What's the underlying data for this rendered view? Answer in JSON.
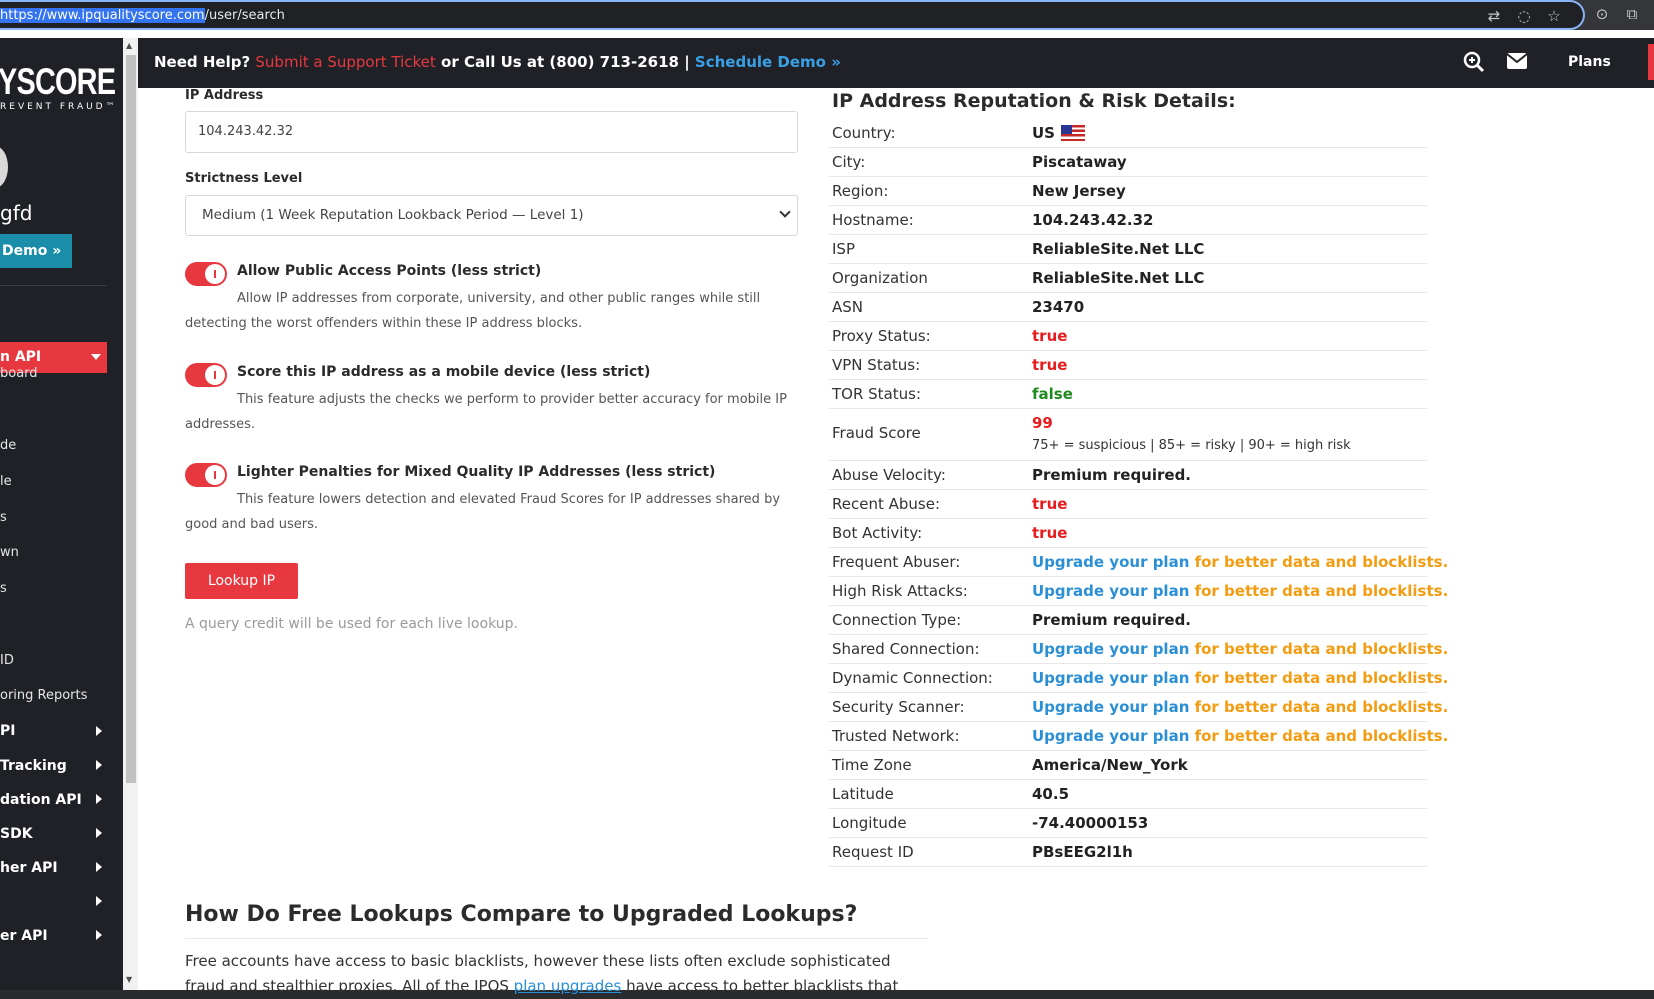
{
  "browser": {
    "url_selected": "https://www.ipqualityscore.com",
    "url_rest": "/user/search",
    "icons": [
      "translate-icon",
      "eye-off-icon",
      "star-icon",
      "share-icon",
      "extensions-icon"
    ]
  },
  "sidebar": {
    "brand": "YSCORE",
    "tagline": "REVENT FRAUD™",
    "username": "gfd",
    "demo_button": "Demo »",
    "active_item": "n API",
    "items": [
      {
        "label": "board"
      },
      {
        "label": "de"
      },
      {
        "label": "le"
      },
      {
        "label": "s"
      },
      {
        "label": "wn"
      },
      {
        "label": "s"
      },
      {
        "label": "ID"
      },
      {
        "label": "oring Reports"
      }
    ],
    "expandable": [
      {
        "label": "PI"
      },
      {
        "label": "Tracking"
      },
      {
        "label": "dation API"
      },
      {
        "label": "SDK"
      },
      {
        "label": "her API"
      },
      {
        "label": ""
      },
      {
        "label": "er API"
      }
    ]
  },
  "topnav": {
    "need_help": "Need Help?",
    "ticket": "Submit a Support Ticket",
    "call": "or Call Us at (800) 713-2618 |",
    "demo": "Schedule Demo »",
    "plans": "Plans"
  },
  "form": {
    "ip_label": "IP Address",
    "ip_value": "104.243.42.32",
    "strictness_label": "Strictness Level",
    "strictness_value": "Medium (1 Week Reputation Lookback Period — Level 1)",
    "options": [
      {
        "title": "Allow Public Access Points (less strict)",
        "desc": "Allow IP addresses from corporate, university, and other public ranges while still detecting the worst offenders within these IP address blocks.",
        "enabled": true
      },
      {
        "title": "Score this IP address as a mobile device (less strict)",
        "desc": "This feature adjusts the checks we perform to provider better accuracy for mobile IP addresses.",
        "enabled": true
      },
      {
        "title": "Lighter Penalties for Mixed Quality IP Addresses (less strict)",
        "desc": "This feature lowers detection and elevated Fraud Scores for IP addresses shared by good and bad users.",
        "enabled": true
      }
    ],
    "lookup_button": "Lookup IP",
    "credit_note": "A query credit will be used for each live lookup."
  },
  "details": {
    "title": "IP Address Reputation & Risk Details:",
    "upgrade_link": "Upgrade your plan",
    "upgrade_rest": " for better data and blocklists.",
    "rows": [
      {
        "key": "Country:",
        "value": "US"
      },
      {
        "key": "City:",
        "value": "Piscataway"
      },
      {
        "key": "Region:",
        "value": "New Jersey"
      },
      {
        "key": "Hostname:",
        "value": "104.243.42.32"
      },
      {
        "key": "ISP",
        "value": "ReliableSite.Net LLC"
      },
      {
        "key": "Organization",
        "value": "ReliableSite.Net LLC"
      },
      {
        "key": "ASN",
        "value": "23470"
      },
      {
        "key": "Proxy Status:",
        "value": "true"
      },
      {
        "key": "VPN Status:",
        "value": "true"
      },
      {
        "key": "TOR Status:",
        "value": "false"
      },
      {
        "key": "Fraud Score",
        "value": "99",
        "sub": "75+ = suspicious | 85+ = risky | 90+ = high risk"
      },
      {
        "key": "Abuse Velocity:",
        "value": "Premium required."
      },
      {
        "key": "Recent Abuse:",
        "value": "true"
      },
      {
        "key": "Bot Activity:",
        "value": "true"
      },
      {
        "key": "Frequent Abuser:",
        "value": ""
      },
      {
        "key": "High Risk Attacks:",
        "value": ""
      },
      {
        "key": "Connection Type:",
        "value": "Premium required."
      },
      {
        "key": "Shared Connection:",
        "value": ""
      },
      {
        "key": "Dynamic Connection:",
        "value": ""
      },
      {
        "key": "Security Scanner:",
        "value": ""
      },
      {
        "key": "Trusted Network:",
        "value": ""
      },
      {
        "key": "Time Zone",
        "value": "America/New_York"
      },
      {
        "key": "Latitude",
        "value": "40.5"
      },
      {
        "key": "Longitude",
        "value": "-74.40000153"
      },
      {
        "key": "Request ID",
        "value": "PBsEEG2l1h"
      }
    ]
  },
  "compare": {
    "title": "How Do Free Lookups Compare to Upgraded Lookups?",
    "text_start": "Free accounts have access to basic blacklists, however these lists often exclude sophisticated fraud and stealthier proxies. All of the IPQS ",
    "link": "plan upgrades",
    "text_end": " have access to better blacklists that"
  },
  "colors": {
    "accent_red": "#e8383f",
    "link_blue": "#2b8fd6",
    "upgrade_orange": "#f39c12",
    "dark_nav": "#1f2127"
  }
}
